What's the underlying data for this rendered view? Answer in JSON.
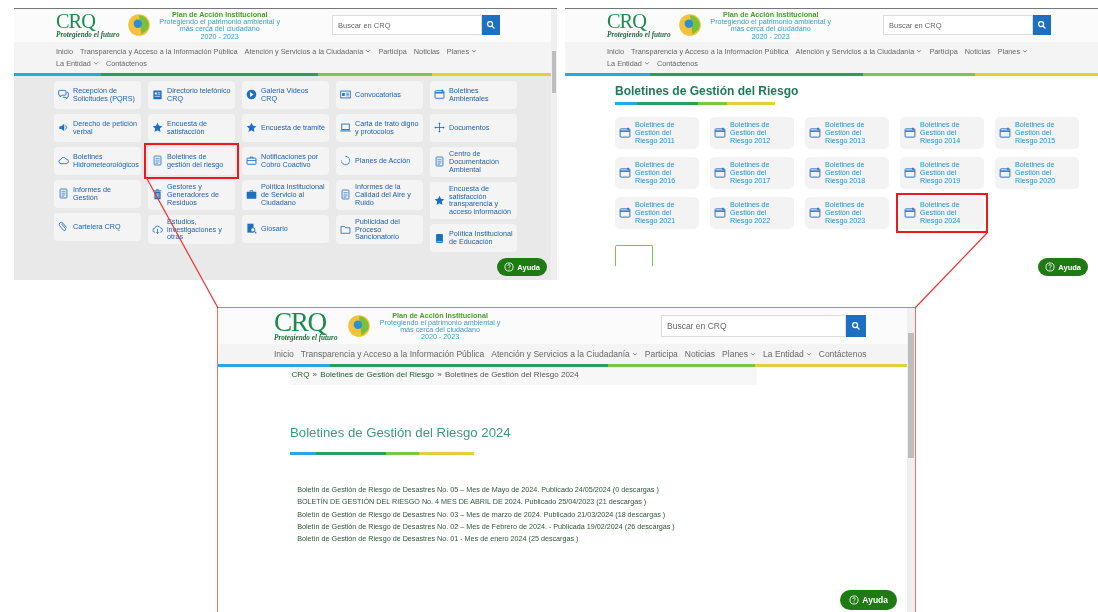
{
  "panels": [
    {
      "kind": "menu",
      "header": {
        "logo_text": "CRQ",
        "logo_tagline": "Protegiendo el futuro",
        "plan_title": "Plan de Acción Institucional",
        "plan_tagline": "Protegiendo el patrimonio ambiental y más cerca del ciudadano",
        "plan_years": "2020 - 2023",
        "search_placeholder": "Buscar en CRQ",
        "nav": [
          {
            "label": "Inicio",
            "dropdown": false
          },
          {
            "label": "Transparencia y Acceso a la Información Pública",
            "dropdown": false
          },
          {
            "label": "Atención y Servicios a la Ciudadanía",
            "dropdown": true
          },
          {
            "label": "Participa",
            "dropdown": false
          },
          {
            "label": "Noticias",
            "dropdown": false
          },
          {
            "label": "Planes",
            "dropdown": true
          },
          {
            "label": "La Entidad",
            "dropdown": true
          },
          {
            "label": "Contáctenos",
            "dropdown": false
          }
        ]
      },
      "columns": [
        {
          "tiles": [
            {
              "label": "Recepción de Solicitudes (PQRS)",
              "highlighted": false
            },
            {
              "label": "Derecho de petición verbal",
              "highlighted": false
            },
            {
              "label": "Boletines Hidrometeorológicos",
              "highlighted": false
            },
            {
              "label": "Informes de Gestión",
              "highlighted": false
            },
            {
              "label": "Cartelera CRQ",
              "highlighted": false
            }
          ]
        },
        {
          "tiles": [
            {
              "label": "Directorio telefónico CRQ",
              "highlighted": false
            },
            {
              "label": "Encuesta de satisfacción",
              "highlighted": false
            },
            {
              "label": "Boletines de gestión del riesgo",
              "highlighted": true
            },
            {
              "label": "Gestores y Generadores de Residuos",
              "highlighted": false
            },
            {
              "label": "Estudios, investigaciones y otras",
              "highlighted": false
            }
          ]
        },
        {
          "tiles": [
            {
              "label": "Galería Videos CRQ",
              "highlighted": false
            },
            {
              "label": "Encuesta de tramite",
              "highlighted": false
            },
            {
              "label": "Notificaciones por Cobro Coactivo",
              "highlighted": false
            },
            {
              "label": "Política Institucional de Servicio al Ciudadano",
              "highlighted": false
            },
            {
              "label": "Glosario",
              "highlighted": false
            }
          ]
        },
        {
          "tiles": [
            {
              "label": "Convocatorias",
              "highlighted": false
            },
            {
              "label": "Carta de trato digno y protocolos",
              "highlighted": false
            },
            {
              "label": "Planes de Acción",
              "highlighted": false
            },
            {
              "label": "Informes de la Calidad del Aire y Ruido",
              "highlighted": false
            },
            {
              "label": "Publicidad del Proceso Sancionatorio",
              "highlighted": false
            }
          ]
        },
        {
          "tiles": [
            {
              "label": "Boletines Ambientales",
              "highlighted": false
            },
            {
              "label": "Documentos",
              "highlighted": false
            },
            {
              "label": "Centro de Documentación Ambiental",
              "highlighted": false
            },
            {
              "label": "Encuesta de satisfacción transparencia y acceso información",
              "highlighted": false
            },
            {
              "label": "Política Institucional de Educación",
              "highlighted": false
            }
          ]
        }
      ],
      "help": "Ayuda"
    },
    {
      "kind": "grid",
      "header": {
        "logo_text": "CRQ",
        "logo_tagline": "Protegiendo el futuro",
        "plan_title": "Plan de Acción Institucional",
        "plan_tagline": "Protegiendo el patrimonio ambiental y más cerca del ciudadano",
        "plan_years": "2020 - 2023",
        "search_placeholder": "Buscar en CRQ",
        "nav": [
          {
            "label": "Inicio",
            "dropdown": false
          },
          {
            "label": "Transparencia y Acceso a la Información Pública",
            "dropdown": false
          },
          {
            "label": "Atención y Servicios a la Ciudadanía",
            "dropdown": true
          },
          {
            "label": "Participa",
            "dropdown": false
          },
          {
            "label": "Noticias",
            "dropdown": false
          },
          {
            "label": "Planes",
            "dropdown": true
          },
          {
            "label": "La Entidad",
            "dropdown": true
          },
          {
            "label": "Contáctenos",
            "dropdown": false
          }
        ]
      },
      "title": "Boletines de Gestión del Riesgo",
      "tiles": [
        {
          "label": "Boletines de Gestión del Riesgo 2011",
          "highlighted": false
        },
        {
          "label": "Boletines de Gestión del Riesgo 2012",
          "highlighted": false
        },
        {
          "label": "Boletines de Gestión del Riesgo 2013",
          "highlighted": false
        },
        {
          "label": "Boletines de Gestión del Riesgo 2014",
          "highlighted": false
        },
        {
          "label": "Boletines de Gestión del Riesgo 2015",
          "highlighted": false
        },
        {
          "label": "Boletines de Gestión del Riesgo 2016",
          "highlighted": false
        },
        {
          "label": "Boletines de Gestión del Riesgo 2017",
          "highlighted": false
        },
        {
          "label": "Boletines de Gestión del Riesgo 2018",
          "highlighted": false
        },
        {
          "label": "Boletines de Gestión del Riesgo 2019",
          "highlighted": false
        },
        {
          "label": "Boletines de Gestión del Riesgo 2020",
          "highlighted": false
        },
        {
          "label": "Boletines de Gestión del Riesgo 2021",
          "highlighted": false
        },
        {
          "label": "Boletines de Gestión del Riesgo 2022",
          "highlighted": false
        },
        {
          "label": "Boletines de Gestión del Riesgo 2023",
          "highlighted": false
        },
        {
          "label": "Boletines de Gestión del Riesgo 2024",
          "highlighted": true
        }
      ],
      "help": "Ayuda"
    },
    {
      "kind": "list",
      "header": {
        "logo_text": "CRQ",
        "logo_tagline": "Protegiendo el futuro",
        "plan_title": "Plan de Acción Institucional",
        "plan_tagline": "Protegiendo el patrimonio ambiental y más cerca del ciudadano",
        "plan_years": "2020 - 2023",
        "search_placeholder": "Buscar en CRQ",
        "nav": [
          {
            "label": "Inicio",
            "dropdown": false
          },
          {
            "label": "Transparencia y Acceso a la Información Pública",
            "dropdown": false
          },
          {
            "label": "Atención y Servicios a la Ciudadanía",
            "dropdown": true
          },
          {
            "label": "Participa",
            "dropdown": false
          },
          {
            "label": "Noticias",
            "dropdown": false
          },
          {
            "label": "Planes",
            "dropdown": true
          },
          {
            "label": "La Entidad",
            "dropdown": true
          },
          {
            "label": "Contáctenos",
            "dropdown": false
          }
        ]
      },
      "breadcrumb": {
        "separator": "»",
        "items": [
          {
            "label": "CRQ",
            "link": true
          },
          {
            "label": "Boletines de Gestión del Riesgo",
            "link": true
          },
          {
            "label": "Boletines de Gestión del Riesgo 2024",
            "link": false
          }
        ]
      },
      "title": "Boletines de Gestión del Riesgo 2024",
      "bulletins": [
        "Boletín de Gestión de Riesgo de Desastres No. 05 – Mes de Mayo de 2024. Publicado 24/05/2024 (0 descargas )",
        "BOLETÍN DE GESTIÓN DEL RIESGO No. 4 MES DE ABRIL DE 2024. Publicado 25/04/2023 (21 descargas )",
        "Boletín de Gestión de Riesgo de Desastres No. 03 – Mes de marzo de 2024. Publicado 21/03/2024 (18 descargas )",
        "Boletín de Gestión de Riesgo de Desastres No. 02 – Mes de Febrero de 2024. - Publicada 19/02/2024 (26 descargas )",
        "Boletín de Gestión de Riesgo de Desastres No. 01 - Mes de enero 2024 (25 descargas )"
      ],
      "help": "Ayuda"
    }
  ]
}
